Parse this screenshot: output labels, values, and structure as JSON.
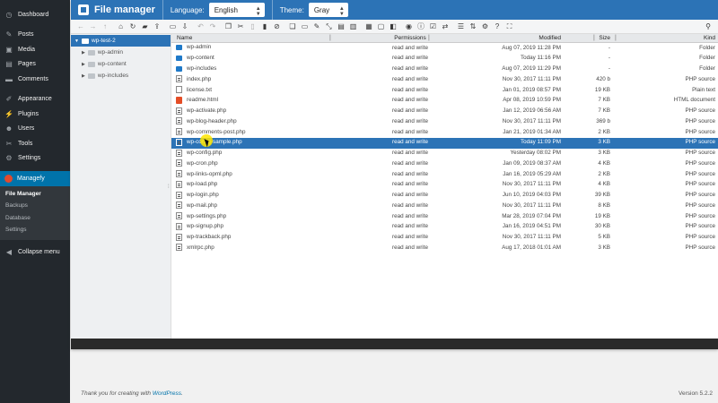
{
  "sidebar": {
    "items": [
      {
        "label": "Dashboard",
        "icon": "dashboard-icon",
        "glyph": "◷"
      },
      {
        "sep": true
      },
      {
        "label": "Posts",
        "icon": "pin-icon",
        "glyph": "✎"
      },
      {
        "label": "Media",
        "icon": "media-icon",
        "glyph": "▣"
      },
      {
        "label": "Pages",
        "icon": "pages-icon",
        "glyph": "▤"
      },
      {
        "label": "Comments",
        "icon": "comments-icon",
        "glyph": "▬"
      },
      {
        "sep": true
      },
      {
        "label": "Appearance",
        "icon": "brush-icon",
        "glyph": "✐"
      },
      {
        "label": "Plugins",
        "icon": "plugin-icon",
        "glyph": "⚡"
      },
      {
        "label": "Users",
        "icon": "users-icon",
        "glyph": "☻"
      },
      {
        "label": "Tools",
        "icon": "wrench-icon",
        "glyph": "✂"
      },
      {
        "label": "Settings",
        "icon": "settings-icon",
        "glyph": "⚙"
      },
      {
        "sep": true
      },
      {
        "label": "Managefy",
        "icon": "managefy-icon",
        "active": true
      }
    ],
    "submenu": [
      {
        "label": "File Manager",
        "current": true
      },
      {
        "label": "Backups"
      },
      {
        "label": "Database"
      },
      {
        "label": "Settings"
      }
    ],
    "collapse_label": "Collapse menu"
  },
  "header": {
    "title": "File manager",
    "language_label": "Language:",
    "language_value": "English",
    "theme_label": "Theme:",
    "theme_value": "Gray"
  },
  "toolbar": {
    "buttons": [
      {
        "name": "back-icon",
        "g": "←",
        "dim": true
      },
      {
        "name": "forward-icon",
        "g": "→",
        "dim": true
      },
      {
        "name": "up-icon",
        "g": "↑",
        "dim": true
      },
      {
        "gap": true
      },
      {
        "name": "home-icon",
        "g": "⌂"
      },
      {
        "name": "reload-icon",
        "g": "↻"
      },
      {
        "name": "new-folder-icon",
        "g": "▰"
      },
      {
        "name": "upload-icon",
        "g": "⇪"
      },
      {
        "gap": true
      },
      {
        "name": "open-icon",
        "g": "▭"
      },
      {
        "name": "download-icon",
        "g": "⇩"
      },
      {
        "gap": true
      },
      {
        "name": "undo-icon",
        "g": "↶",
        "dim": true
      },
      {
        "name": "redo-icon",
        "g": "↷",
        "dim": true
      },
      {
        "gap": true
      },
      {
        "name": "copy-icon",
        "g": "❐"
      },
      {
        "name": "cut-icon",
        "g": "✂"
      },
      {
        "name": "paste-icon",
        "g": "▯",
        "dim": true
      },
      {
        "name": "delete-icon",
        "g": "▮"
      },
      {
        "name": "empty-icon",
        "g": "⊘"
      },
      {
        "gap": true
      },
      {
        "name": "duplicate-icon",
        "g": "❏"
      },
      {
        "name": "rename-icon",
        "g": "▭"
      },
      {
        "name": "edit-icon",
        "g": "✎"
      },
      {
        "name": "resize-icon",
        "g": "⤡"
      },
      {
        "name": "archive-icon",
        "g": "▤"
      },
      {
        "name": "extract-icon",
        "g": "▥"
      },
      {
        "gap": true
      },
      {
        "name": "select-all-icon",
        "g": "▦"
      },
      {
        "name": "select-none-icon",
        "g": "▢"
      },
      {
        "name": "invert-icon",
        "g": "◧"
      },
      {
        "gap": true
      },
      {
        "name": "preview-icon",
        "g": "◉"
      },
      {
        "name": "info-icon",
        "g": "ⓘ"
      },
      {
        "name": "permissions-icon",
        "g": "☑"
      },
      {
        "name": "netmount-icon",
        "g": "⇄"
      },
      {
        "gap": true
      },
      {
        "name": "view-icon",
        "g": "☰"
      },
      {
        "name": "sort-icon",
        "g": "⇅"
      },
      {
        "name": "preferences-icon",
        "g": "⚙"
      },
      {
        "name": "help-icon",
        "g": "?"
      },
      {
        "name": "fullscreen-icon",
        "g": "⛶"
      }
    ],
    "search_glyph": "⚲"
  },
  "tree": {
    "root": "wp-test-2",
    "children": [
      "wp-admin",
      "wp-content",
      "wp-includes"
    ]
  },
  "columns": {
    "name": "Name",
    "permissions": "Permissions",
    "modified": "Modified",
    "size": "Size",
    "kind": "Kind"
  },
  "files": [
    {
      "name": "wp-admin",
      "type": "folder",
      "perm": "read and write",
      "mod": "Aug 07, 2019 11:28 PM",
      "size": "-",
      "kind": "Folder"
    },
    {
      "name": "wp-content",
      "type": "folder",
      "perm": "read and write",
      "mod": "Today 11:16 PM",
      "size": "-",
      "kind": "Folder"
    },
    {
      "name": "wp-includes",
      "type": "folder",
      "perm": "read and write",
      "mod": "Aug 07, 2019 11:29 PM",
      "size": "-",
      "kind": "Folder"
    },
    {
      "name": "index.php",
      "type": "php",
      "perm": "read and write",
      "mod": "Nov 30, 2017 11:11 PM",
      "size": "420 b",
      "kind": "PHP source"
    },
    {
      "name": "license.txt",
      "type": "txt",
      "perm": "read and write",
      "mod": "Jan 01, 2019 08:57 PM",
      "size": "19 KB",
      "kind": "Plain text"
    },
    {
      "name": "readme.html",
      "type": "html",
      "perm": "read and write",
      "mod": "Apr 08, 2019 10:59 PM",
      "size": "7 KB",
      "kind": "HTML document"
    },
    {
      "name": "wp-activate.php",
      "type": "php",
      "perm": "read and write",
      "mod": "Jan 12, 2019 06:56 AM",
      "size": "7 KB",
      "kind": "PHP source"
    },
    {
      "name": "wp-blog-header.php",
      "type": "php",
      "perm": "read and write",
      "mod": "Nov 30, 2017 11:11 PM",
      "size": "369 b",
      "kind": "PHP source"
    },
    {
      "name": "wp-comments-post.php",
      "type": "php",
      "perm": "read and write",
      "mod": "Jan 21, 2019 01:34 AM",
      "size": "2 KB",
      "kind": "PHP source"
    },
    {
      "name": "wp-config-sample.php",
      "type": "php",
      "perm": "read and write",
      "mod": "Today 11:09 PM",
      "size": "3 KB",
      "kind": "PHP source",
      "selected": true
    },
    {
      "name": "wp-config.php",
      "type": "php",
      "perm": "read and write",
      "mod": "Yesterday 08:02 PM",
      "size": "3 KB",
      "kind": "PHP source"
    },
    {
      "name": "wp-cron.php",
      "type": "php",
      "perm": "read and write",
      "mod": "Jan 09, 2019 08:37 AM",
      "size": "4 KB",
      "kind": "PHP source"
    },
    {
      "name": "wp-links-opml.php",
      "type": "php",
      "perm": "read and write",
      "mod": "Jan 16, 2019 05:29 AM",
      "size": "2 KB",
      "kind": "PHP source"
    },
    {
      "name": "wp-load.php",
      "type": "php",
      "perm": "read and write",
      "mod": "Nov 30, 2017 11:11 PM",
      "size": "4 KB",
      "kind": "PHP source"
    },
    {
      "name": "wp-login.php",
      "type": "php",
      "perm": "read and write",
      "mod": "Jun 10, 2019 04:03 PM",
      "size": "39 KB",
      "kind": "PHP source"
    },
    {
      "name": "wp-mail.php",
      "type": "php",
      "perm": "read and write",
      "mod": "Nov 30, 2017 11:11 PM",
      "size": "8 KB",
      "kind": "PHP source"
    },
    {
      "name": "wp-settings.php",
      "type": "php",
      "perm": "read and write",
      "mod": "Mar 28, 2019 07:04 PM",
      "size": "19 KB",
      "kind": "PHP source"
    },
    {
      "name": "wp-signup.php",
      "type": "php",
      "perm": "read and write",
      "mod": "Jan 16, 2019 04:51 PM",
      "size": "30 KB",
      "kind": "PHP source"
    },
    {
      "name": "wp-trackback.php",
      "type": "php",
      "perm": "read and write",
      "mod": "Nov 30, 2017 11:11 PM",
      "size": "5 KB",
      "kind": "PHP source"
    },
    {
      "name": "xmlrpc.php",
      "type": "php",
      "perm": "read and write",
      "mod": "Aug 17, 2018 01:01 AM",
      "size": "3 KB",
      "kind": "PHP source"
    }
  ],
  "footer": {
    "thanks_prefix": "Thank you for creating with ",
    "thanks_link": "WordPress",
    "thanks_suffix": ".",
    "version": "Version 5.2.2"
  }
}
